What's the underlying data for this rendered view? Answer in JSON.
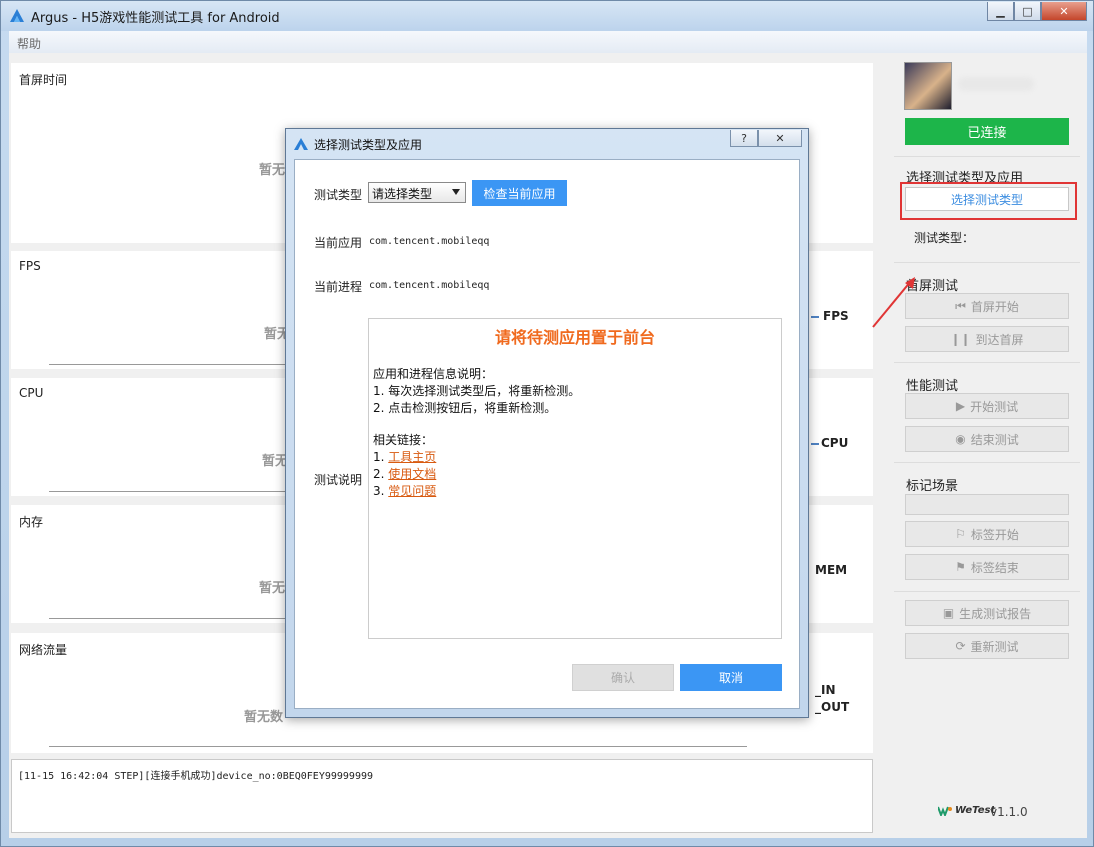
{
  "window": {
    "title": "Argus - H5游戏性能测试工具 for Android",
    "minimize": "▁",
    "maximize": "□",
    "close": "✕"
  },
  "menu": {
    "help": "帮助"
  },
  "panels": [
    {
      "title": "首屏时间",
      "no_data": "暂无"
    },
    {
      "title": "FPS",
      "no_data": "暂无",
      "legend": "FPS"
    },
    {
      "title": "CPU",
      "no_data": "暂无",
      "legend": "CPU"
    },
    {
      "title": "内存",
      "no_data": "暂无",
      "legend": "MEM"
    },
    {
      "title": "网络流量",
      "no_data": "暂无数",
      "legend_in": "_IN",
      "legend_out": "_OUT"
    }
  ],
  "log": {
    "text": "[11-15 16:42:04 STEP][连接手机成功]device_no:0BEQ0FEY99999999"
  },
  "sidebar": {
    "connected": "已连接",
    "select_section": "选择测试类型及应用",
    "select_type_button": "选择测试类型",
    "test_type_label": "测试类型：",
    "first_screen_section": "首屏测试",
    "first_screen_start": "首屏开始",
    "first_screen_reach": "到达首屏",
    "perf_section": "性能测试",
    "perf_start": "开始测试",
    "perf_end": "结束测试",
    "mark_section": "标记场景",
    "tag_start": "标签开始",
    "tag_end": "标签结束",
    "gen_report": "生成测试报告",
    "retest": "重新测试",
    "brand": "WeTest",
    "version": "v1.1.0"
  },
  "dialog": {
    "title": "选择测试类型及应用",
    "help_btn": "?",
    "close_btn": "✕",
    "test_type_label": "测试类型",
    "test_type_value": "请选择类型",
    "check_app_button": "检查当前应用",
    "current_app_label": "当前应用",
    "current_app_value": "com.tencent.mobileqq",
    "current_process_label": "当前进程",
    "current_process_value": "com.tencent.mobileqq",
    "description_label": "测试说明",
    "headline": "请将待测应用置于前台",
    "info_title": "应用和进程信息说明：",
    "info_1": "1. 每次选择测试类型后，将重新检测。",
    "info_2": "2. 点击检测按钮后，将重新检测。",
    "links_title": "相关链接：",
    "link_1_prefix": "1. ",
    "link_1": "工具主页",
    "link_2_prefix": "2. ",
    "link_2": "使用文档",
    "link_3_prefix": "3. ",
    "link_3": "常见问题",
    "confirm": "确认",
    "cancel": "取消"
  },
  "colors": {
    "connected_green": "#1db54a",
    "primary_blue": "#3b96f4",
    "headline_orange": "#f06a1e",
    "highlight_red": "#e03535"
  }
}
